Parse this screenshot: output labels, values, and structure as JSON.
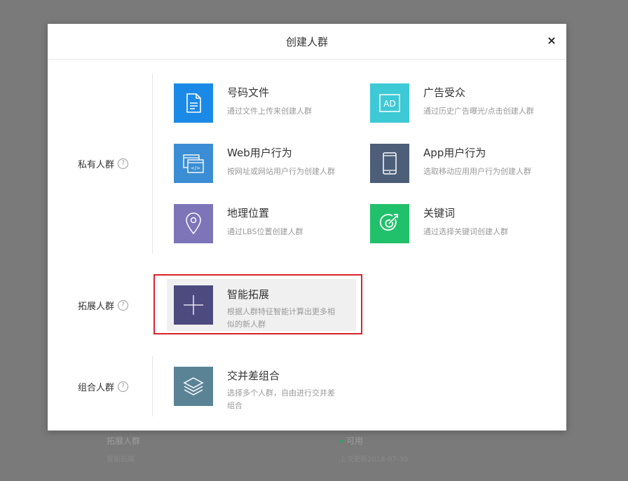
{
  "dialog": {
    "title": "创建人群",
    "close_label": "×"
  },
  "sections": {
    "private": {
      "label": "私有人群",
      "help": "?"
    },
    "expand": {
      "label": "拓展人群",
      "help": "?"
    },
    "combine": {
      "label": "组合人群",
      "help": "?"
    }
  },
  "cards": {
    "number_file": {
      "title": "号码文件",
      "desc": "通过文件上传来创建人群",
      "color": "#1a8ae6",
      "icon": "document-icon"
    },
    "ad_audience": {
      "title": "广告受众",
      "desc": "通过历史广告曝光/点击创建人群",
      "color": "#3ec9d6",
      "icon": "ad-icon",
      "icon_text": "AD"
    },
    "web_behavior": {
      "title": "Web用户行为",
      "desc": "按网址或网站用户行为创建人群",
      "color": "#3b8ed4",
      "icon": "web-browser-icon"
    },
    "app_behavior": {
      "title": "App用户行为",
      "desc": "选取移动应用用户行为创建人群",
      "color": "#4d5e78",
      "icon": "mobile-phone-icon"
    },
    "geo_location": {
      "title": "地理位置",
      "desc": "通过LBS位置创建人群",
      "color": "#7d75b8",
      "icon": "location-pin-icon"
    },
    "keyword": {
      "title": "关键词",
      "desc": "通过选择关键词创建人群",
      "color": "#21c16b",
      "icon": "target-icon"
    },
    "smart_expand": {
      "title": "智能拓展",
      "desc_line1": "根据人群特征智能计算出更多相",
      "desc_line2": "似的新人群",
      "color": "#4d4a80",
      "icon": "plus-icon"
    },
    "intersection": {
      "title": "交并差组合",
      "desc_line1": "选择多个人群，自由进行交并差",
      "desc_line2": "组合",
      "color": "#5b8396",
      "icon": "layers-icon"
    }
  },
  "background": {
    "col1_title": "拓展人群",
    "col1_sub": "智能拓展",
    "col2_title": "可用",
    "col2_sub": "上次更新2018-07-30"
  }
}
